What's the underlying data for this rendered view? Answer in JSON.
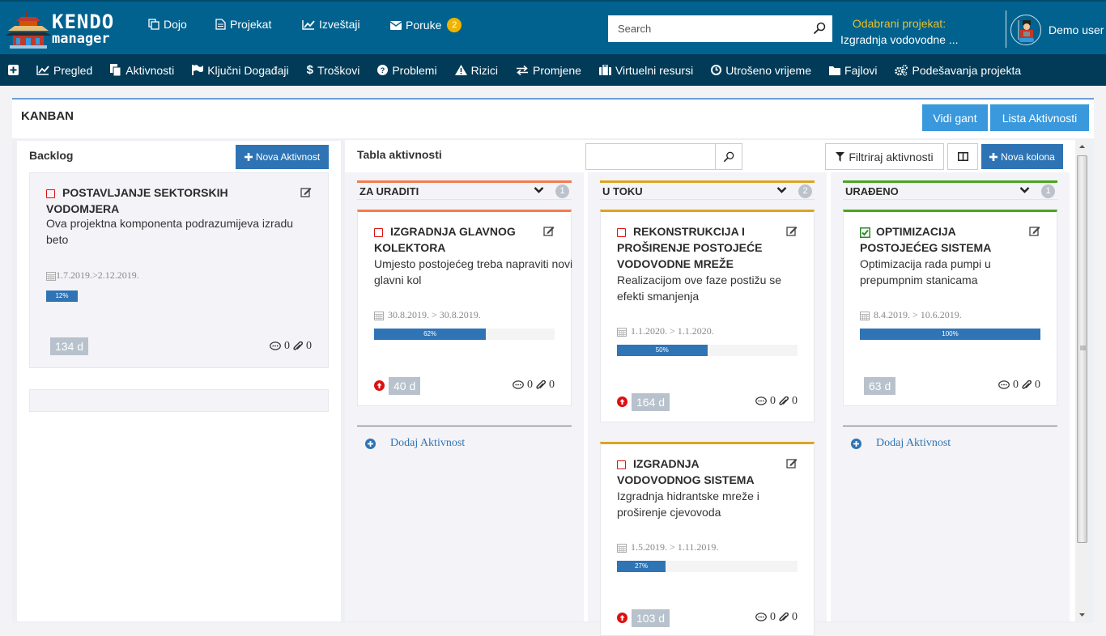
{
  "header": {
    "logo_word": "KENDO",
    "logo_sub": "manager",
    "nav": [
      {
        "label": "Dojo",
        "icon": "copy-icon"
      },
      {
        "label": "Projekat",
        "icon": "document-icon"
      },
      {
        "label": "Izveštaji",
        "icon": "line-chart-icon"
      },
      {
        "label": "Poruke",
        "icon": "envelope-icon",
        "badge": "2"
      }
    ],
    "search_placeholder": "Search",
    "selected_project_label": "Odabrani projekat:",
    "selected_project_value": "Izgradnja vodovodne ...",
    "user_name": "Demo user"
  },
  "subnav": [
    {
      "label": "",
      "icon": "plus-square-icon"
    },
    {
      "label": "Pregled",
      "icon": "line-chart-icon"
    },
    {
      "label": "Aktivnosti",
      "icon": "files-icon"
    },
    {
      "label": "Ključni Događaji",
      "icon": "flag-icon"
    },
    {
      "label": "Troškovi",
      "icon": "dollar-icon"
    },
    {
      "label": "Problemi",
      "icon": "question-circle-icon"
    },
    {
      "label": "Rizici",
      "icon": "warning-icon"
    },
    {
      "label": "Promjene",
      "icon": "exchange-icon"
    },
    {
      "label": "Virtuelni resursi",
      "icon": "suitcase-icon"
    },
    {
      "label": "Utrošeno vrijeme",
      "icon": "clock-icon"
    },
    {
      "label": "Fajlovi",
      "icon": "folder-icon"
    },
    {
      "label": "Podešavanja projekta",
      "icon": "gears-icon"
    }
  ],
  "page": {
    "title": "KANBAN",
    "btn_gantt": "Vidi gant",
    "btn_list": "Lista Aktivnosti"
  },
  "backlog": {
    "title": "Backlog",
    "new_btn": "Nova Aktivnost",
    "cards": [
      {
        "title": "POSTAVLJANJE SEKTORSKIH VODOMJERA",
        "desc": "Ova projektna komponenta podrazumijeva izradu beto",
        "dates": "1.7.2019.>2.12.2019.",
        "progress": 12,
        "progress_label": "12%",
        "days": "134 d",
        "comments": "0",
        "attachments": "0",
        "done": false
      }
    ]
  },
  "board": {
    "title": "Tabla aktivnosti",
    "search_value": "",
    "filter_btn": "Filtriraj aktivnosti",
    "new_column_btn": "Nova kolona",
    "add_activity": "Dodaj Aktivnost",
    "columns": [
      {
        "name": "ZA URADITI",
        "count": "1",
        "color": "#f47c4c",
        "cards": [
          {
            "title": "IZGRADNJA GLAVNOG KOLEKTORA",
            "desc": "Umjesto postojećeg treba napraviti novi glavni kol",
            "dates": "30.8.2019. > 30.8.2019.",
            "progress": 62,
            "progress_label": "62%",
            "days": "40 d",
            "comments": "0",
            "attachments": "0",
            "done": false,
            "priority_high": true
          }
        ]
      },
      {
        "name": "U TOKU",
        "count": "2",
        "color": "#daa520",
        "cards": [
          {
            "title": "REKONSTRUKCIJA I PROŠIRENJE POSTOJEĆE VODOVODNE MREŽE",
            "desc": "Realizacijom ove faze postižu se efekti smanjenja",
            "dates": "1.1.2020. > 1.1.2020.",
            "progress": 50,
            "progress_label": "50%",
            "days": "164 d",
            "comments": "0",
            "attachments": "0",
            "done": false,
            "priority_high": true
          },
          {
            "title": "IZGRADNJA VODOVODNOG SISTEMA",
            "desc": "Izgradnja hidrantske mreže i proširenje cjevovoda",
            "dates": "1.5.2019. > 1.11.2019.",
            "progress": 27,
            "progress_label": "27%",
            "days": "103 d",
            "comments": "0",
            "attachments": "0",
            "done": false,
            "priority_high": true
          }
        ]
      },
      {
        "name": "URAĐENO",
        "count": "1",
        "color": "#4aa520",
        "cards": [
          {
            "title": "OPTIMIZACIJA POSTOJEĆEG SISTEMA",
            "desc": "Optimizacija rada pumpi u prepumpnim stanicama",
            "dates": "8.4.2019. > 10.6.2019.",
            "progress": 100,
            "progress_label": "100%",
            "days": "63 d",
            "comments": "0",
            "attachments": "0",
            "done": true,
            "priority_high": false
          }
        ]
      }
    ]
  }
}
